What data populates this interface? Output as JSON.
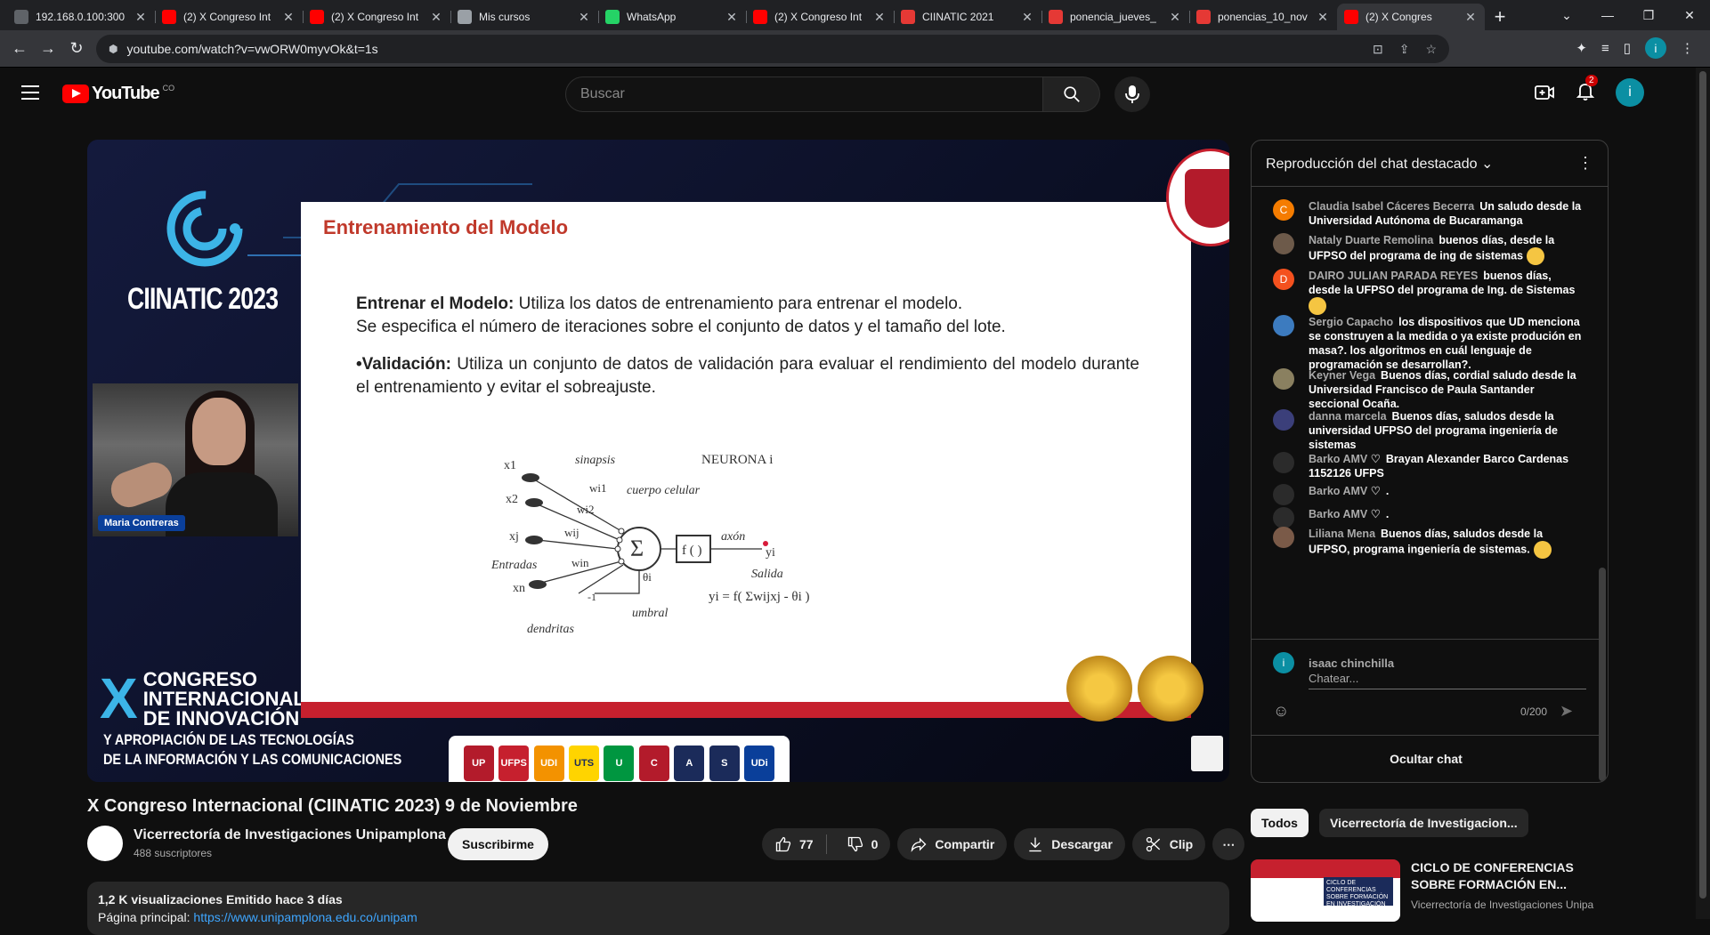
{
  "browser": {
    "tabs": [
      {
        "title": "192.168.0.100:300",
        "icon": "network-icon",
        "color": "#5f6368"
      },
      {
        "title": "(2) X Congreso Int",
        "icon": "youtube-icon",
        "color": "#ff0000"
      },
      {
        "title": "(2) X Congreso Int",
        "icon": "youtube-icon",
        "color": "#ff0000"
      },
      {
        "title": "Mis cursos",
        "icon": "doc-icon",
        "color": "#9aa0a6"
      },
      {
        "title": "WhatsApp",
        "icon": "whatsapp-icon",
        "color": "#25d366"
      },
      {
        "title": "(2) X Congreso Int",
        "icon": "youtube-icon",
        "color": "#ff0000"
      },
      {
        "title": "CIINATIC 2021",
        "icon": "u-icon",
        "color": "#e53935"
      },
      {
        "title": "ponencia_jueves_",
        "icon": "u-icon",
        "color": "#e53935"
      },
      {
        "title": "ponencias_10_nov",
        "icon": "u-icon",
        "color": "#e53935"
      },
      {
        "title": "(2) X Congres",
        "icon": "youtube-icon",
        "color": "#ff0000"
      }
    ],
    "url": "youtube.com/watch?v=vwORW0myvOk&t=1s",
    "profile_initial": "i"
  },
  "youtube": {
    "logo_text": "YouTube",
    "country_code": "CO",
    "search_placeholder": "Buscar",
    "notification_count": "2",
    "avatar_initial": "i"
  },
  "video": {
    "event_name": "CIINATIC 2023",
    "speaker_name": "Maria Contreras",
    "congress_x": "X",
    "congress_lines": [
      "CONGRESO",
      "INTERNACIONAL",
      "DE INNOVACIÓN"
    ],
    "congress_tagline": [
      "Y APROPIACIÓN DE LAS TECNOLOGÍAS",
      "DE LA INFORMACIÓN Y LAS COMUNICACIONES"
    ],
    "slide_title": "Entrenamiento del Modelo",
    "slide_p1_label": "Entrenar el Modelo:",
    "slide_p1_text": " Utiliza los datos de entrenamiento para entrenar el modelo.",
    "slide_p1_text2": "Se especifica el número de iteraciones sobre el conjunto de datos y el tamaño del lote.",
    "slide_p2_label": "•Validación:",
    "slide_p2_text": " Utiliza un conjunto de datos de validación para evaluar el rendimiento del modelo durante el entrenamiento y evitar el sobreajuste.",
    "diagram": {
      "neurona": "NEURONA i",
      "sinapsis": "sinapsis",
      "cuerpo": "cuerpo celular",
      "axon": "axón",
      "salida": "Salida",
      "entradas": "Entradas",
      "dendritas": "dendritas",
      "umbral": "umbral",
      "sigma": "Σ",
      "func": "f ( )",
      "minus_one": "-1",
      "x1": "x1",
      "x2": "x2",
      "xj": "xj",
      "xn": "xn",
      "wi1": "wi1",
      "wi2": "wi2",
      "wij": "wij",
      "win": "win",
      "theta": "θi",
      "yi": "yi",
      "formula": "yi = f( Σwijxj - θi )"
    },
    "strip_logos": [
      "UP",
      "UFPS",
      "UDI",
      "UTS",
      "U",
      "C",
      "A",
      "S",
      "UDi"
    ],
    "strip_colors": [
      "#b31b2b",
      "#c6202e",
      "#f39200",
      "#ffd400",
      "#009640",
      "#b31b2b",
      "#1b2b5a",
      "#1b2b5a",
      "#0a3f9a"
    ]
  },
  "meta": {
    "title": "X Congreso Internacional (CIINATIC 2023) 9 de Noviembre",
    "channel": "Vicerrectoría de Investigaciones Unipamplona",
    "subscribers": "488 suscriptores",
    "subscribe_label": "Suscribirme",
    "likes": "77",
    "dislikes": "0",
    "share_label": "Compartir",
    "download_label": "Descargar",
    "clip_label": "Clip",
    "views_line": "1,2 K visualizaciones  Emitido hace 3 días",
    "homepage_label": "Página principal: ",
    "homepage_link": "https://www.unipamplona.edu.co/unipam"
  },
  "chat": {
    "header": "Reproducción del chat destacado",
    "messages": [
      {
        "author": "Claudia Isabel Cáceres Becerra",
        "text": "Un saludo desde la Universidad Autónoma de Bucaramanga",
        "initial": "C",
        "color": "#f57c00"
      },
      {
        "author": "Nataly Duarte Remolina",
        "text": "buenos días, desde la UFPSO del programa de ing de sistemas",
        "initial": "",
        "color": "#6d5a4a"
      },
      {
        "author": "DAIRO JULIAN PARADA REYES",
        "text": "buenos días, desde la UFPSO del programa de Ing. de Sistemas",
        "initial": "D",
        "color": "#f4511e"
      },
      {
        "author": "Sergio Capacho",
        "text": "los dispositivos que UD menciona se construyen a la medida o ya existe produción en masa?. los algoritmos en cuál lenguaje de programación se desarrollan?.",
        "initial": "",
        "color": "#3c7bbf"
      },
      {
        "author": "Keyner Vega",
        "text": "Buenos días, cordial saludo desde la Universidad Francisco de Paula Santander seccional Ocaña.",
        "initial": "",
        "color": "#8a8060"
      },
      {
        "author": "danna marcela",
        "text": "Buenos días, saludos desde la universidad UFPSO del programa ingeniería de sistemas",
        "initial": "",
        "color": "#3b3f7a"
      },
      {
        "author": "Barko AMV ♡",
        "text": "Brayan Alexander Barco Cardenas 1152126 UFPS",
        "initial": "",
        "color": "#2b2b2b"
      },
      {
        "author": "Barko AMV ♡",
        "text": ".",
        "initial": "",
        "color": "#2b2b2b"
      },
      {
        "author": "Barko AMV ♡",
        "text": ".",
        "initial": "",
        "color": "#2b2b2b"
      },
      {
        "author": "Liliana Mena",
        "text": "Buenos días, saludos desde la UFPSO, programa ingeniería de sistemas.",
        "initial": "",
        "color": "#7a5a48"
      }
    ],
    "me_name": "isaac chinchilla",
    "me_initial": "i",
    "input_placeholder": "Chatear...",
    "char_count": "0/200",
    "hide_label": "Ocultar chat"
  },
  "sidebar": {
    "chips": [
      "Todos",
      "Vicerrectoría de Investigacion..."
    ],
    "rec_title": "CICLO DE CONFERENCIAS SOBRE FORMACIÓN EN...",
    "rec_channel": "Vicerrectoría de Investigaciones Unipa",
    "rec_thumb_text": "CICLO DE CONFERENCIAS SOBRE FORMACIÓN EN INVESTIGACIÓN"
  }
}
